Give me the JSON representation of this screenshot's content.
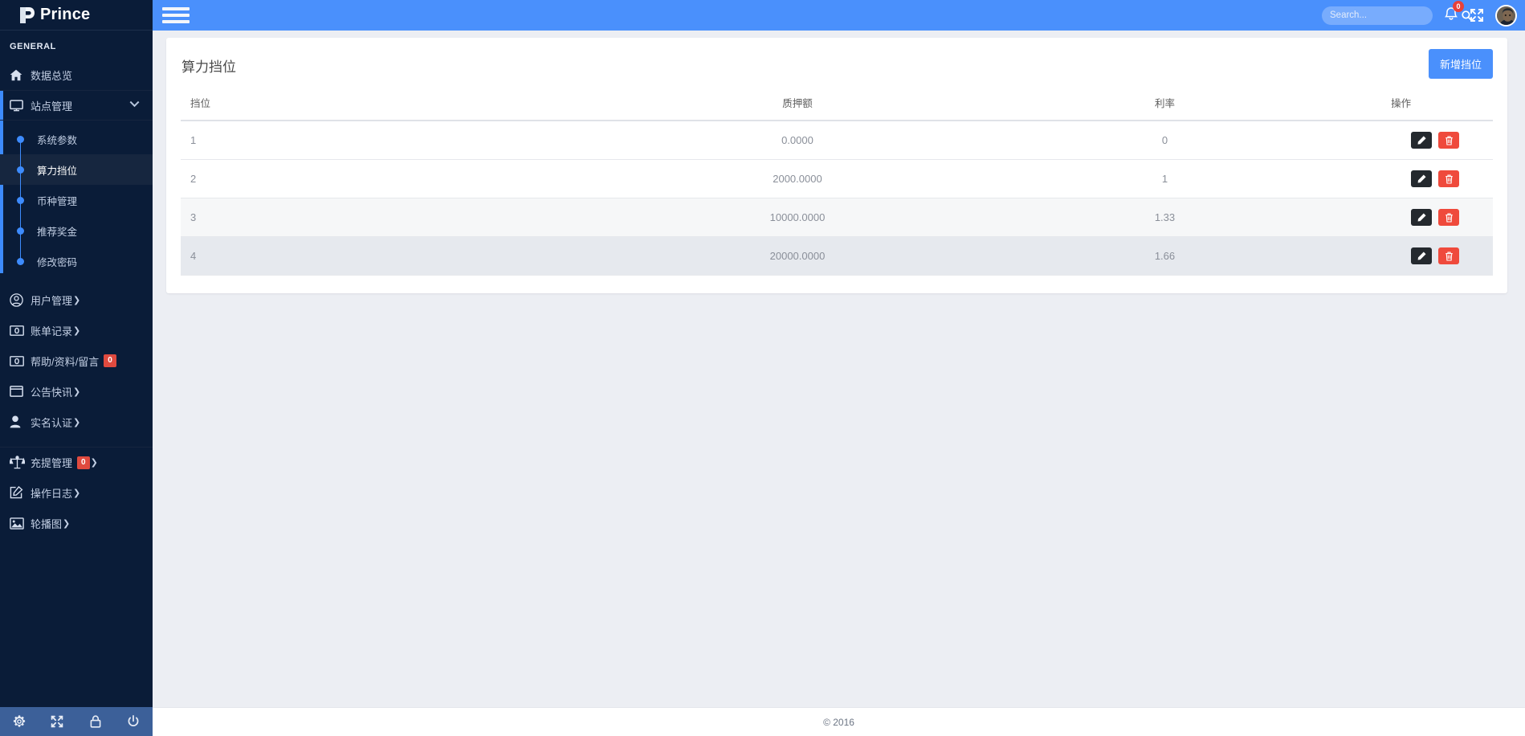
{
  "brand": {
    "name": "Prince",
    "logo_icon": "prince-p-logo"
  },
  "sidebar": {
    "section_label": "GENERAL",
    "items": [
      {
        "label": "数据总览",
        "icon": "home-icon",
        "badge": null,
        "caret": false
      },
      {
        "label": "站点管理",
        "icon": "monitor-icon",
        "badge": null,
        "caret": false,
        "expanded": true
      },
      {
        "label": "用户管理",
        "icon": "user-circle-icon",
        "badge": null,
        "caret": true
      },
      {
        "label": "账单记录",
        "icon": "banknote-icon",
        "badge": null,
        "caret": true
      },
      {
        "label": "帮助/资料/留言",
        "icon": "banknote-icon",
        "badge": "0",
        "caret": false
      },
      {
        "label": "公告快讯",
        "icon": "window-icon",
        "badge": null,
        "caret": true
      },
      {
        "label": "实名认证",
        "icon": "person-icon",
        "badge": null,
        "caret": true
      },
      {
        "label": "充提管理",
        "icon": "scales-icon",
        "badge": "0",
        "caret": true
      },
      {
        "label": "操作日志",
        "icon": "edit-square-icon",
        "badge": null,
        "caret": true
      },
      {
        "label": "轮播图",
        "icon": "image-icon",
        "badge": null,
        "caret": true
      }
    ],
    "submenu": [
      {
        "label": "系统参数",
        "active": false
      },
      {
        "label": "算力挡位",
        "active": true
      },
      {
        "label": "币种管理",
        "active": false
      },
      {
        "label": "推荐奖金",
        "active": false
      },
      {
        "label": "修改密码",
        "active": false
      }
    ],
    "footer_icons": [
      {
        "name": "gear-icon"
      },
      {
        "name": "fullscreen-icon"
      },
      {
        "name": "lock-icon"
      },
      {
        "name": "power-icon"
      }
    ]
  },
  "topnav": {
    "menu_toggle_icon": "hamburger-icon",
    "search": {
      "placeholder": "Search...",
      "value": "",
      "icon": "search-icon"
    },
    "notifications": {
      "icon": "bell-icon",
      "count": "0"
    },
    "fullscreen_icon": "expand-arrows-icon",
    "avatar_icon": "user-avatar"
  },
  "page": {
    "title": "算力挡位",
    "add_button": "新增挡位"
  },
  "table": {
    "columns": [
      "挡位",
      "质押额",
      "利率",
      "操作"
    ],
    "rows": [
      {
        "level": "1",
        "stake": "0.0000",
        "rate": "0",
        "edit": "edit-icon",
        "delete": "trash-icon"
      },
      {
        "level": "2",
        "stake": "2000.0000",
        "rate": "1",
        "edit": "edit-icon",
        "delete": "trash-icon"
      },
      {
        "level": "3",
        "stake": "10000.0000",
        "rate": "1.33",
        "edit": "edit-icon",
        "delete": "trash-icon"
      },
      {
        "level": "4",
        "stake": "20000.0000",
        "rate": "1.66",
        "edit": "edit-icon",
        "delete": "trash-icon"
      }
    ]
  },
  "footer": {
    "copyright": "© 2016"
  },
  "colors": {
    "sidebar_bg": "#0a1c38",
    "navbar_blue": "#4a90fc",
    "accent_blue": "#3d8bfd",
    "badge_red": "#e04a3f",
    "delete_red": "#ef4a3c",
    "edit_dark": "#24292e",
    "page_bg": "#eceef3"
  }
}
